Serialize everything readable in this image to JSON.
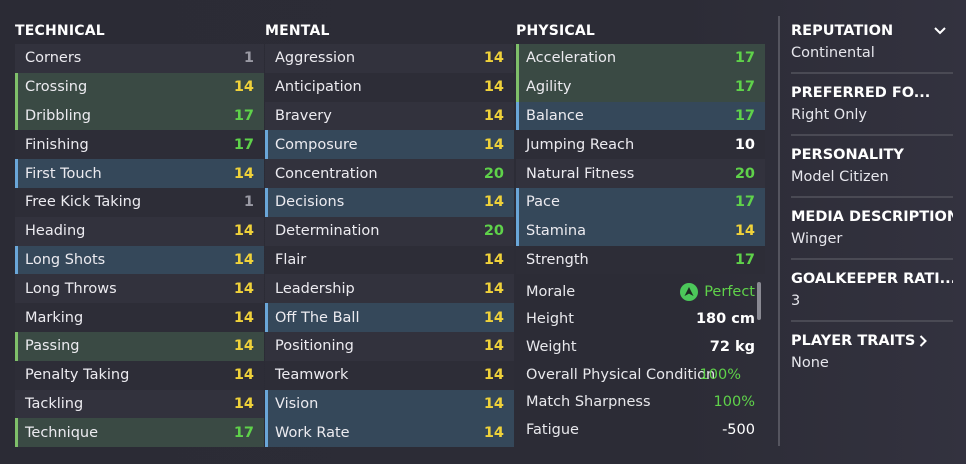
{
  "technical": {
    "title": "TECHNICAL",
    "rows": [
      {
        "name": "Corners",
        "value": "1",
        "color": "gray",
        "hl": ""
      },
      {
        "name": "Crossing",
        "value": "14",
        "color": "yellow",
        "hl": "green"
      },
      {
        "name": "Dribbling",
        "value": "17",
        "color": "green",
        "hl": "green"
      },
      {
        "name": "Finishing",
        "value": "17",
        "color": "green",
        "hl": ""
      },
      {
        "name": "First Touch",
        "value": "14",
        "color": "yellow",
        "hl": "blue"
      },
      {
        "name": "Free Kick Taking",
        "value": "1",
        "color": "gray",
        "hl": ""
      },
      {
        "name": "Heading",
        "value": "14",
        "color": "yellow",
        "hl": ""
      },
      {
        "name": "Long Shots",
        "value": "14",
        "color": "yellow",
        "hl": "blue"
      },
      {
        "name": "Long Throws",
        "value": "14",
        "color": "yellow",
        "hl": ""
      },
      {
        "name": "Marking",
        "value": "14",
        "color": "yellow",
        "hl": ""
      },
      {
        "name": "Passing",
        "value": "14",
        "color": "yellow",
        "hl": "green"
      },
      {
        "name": "Penalty Taking",
        "value": "14",
        "color": "yellow",
        "hl": ""
      },
      {
        "name": "Tackling",
        "value": "14",
        "color": "yellow",
        "hl": ""
      },
      {
        "name": "Technique",
        "value": "17",
        "color": "green",
        "hl": "green"
      }
    ]
  },
  "mental": {
    "title": "MENTAL",
    "rows": [
      {
        "name": "Aggression",
        "value": "14",
        "color": "yellow",
        "hl": ""
      },
      {
        "name": "Anticipation",
        "value": "14",
        "color": "yellow",
        "hl": ""
      },
      {
        "name": "Bravery",
        "value": "14",
        "color": "yellow",
        "hl": ""
      },
      {
        "name": "Composure",
        "value": "14",
        "color": "yellow",
        "hl": "blue"
      },
      {
        "name": "Concentration",
        "value": "20",
        "color": "green",
        "hl": ""
      },
      {
        "name": "Decisions",
        "value": "14",
        "color": "yellow",
        "hl": "blue"
      },
      {
        "name": "Determination",
        "value": "20",
        "color": "green",
        "hl": ""
      },
      {
        "name": "Flair",
        "value": "14",
        "color": "yellow",
        "hl": ""
      },
      {
        "name": "Leadership",
        "value": "14",
        "color": "yellow",
        "hl": ""
      },
      {
        "name": "Off The Ball",
        "value": "14",
        "color": "yellow",
        "hl": "blue"
      },
      {
        "name": "Positioning",
        "value": "14",
        "color": "yellow",
        "hl": ""
      },
      {
        "name": "Teamwork",
        "value": "14",
        "color": "yellow",
        "hl": ""
      },
      {
        "name": "Vision",
        "value": "14",
        "color": "yellow",
        "hl": "blue"
      },
      {
        "name": "Work Rate",
        "value": "14",
        "color": "yellow",
        "hl": "blue"
      }
    ]
  },
  "physical": {
    "title": "PHYSICAL",
    "rows": [
      {
        "name": "Acceleration",
        "value": "17",
        "color": "green",
        "hl": "green"
      },
      {
        "name": "Agility",
        "value": "17",
        "color": "green",
        "hl": "green"
      },
      {
        "name": "Balance",
        "value": "17",
        "color": "green",
        "hl": "blue"
      },
      {
        "name": "Jumping Reach",
        "value": "10",
        "color": "white",
        "hl": ""
      },
      {
        "name": "Natural Fitness",
        "value": "20",
        "color": "green",
        "hl": ""
      },
      {
        "name": "Pace",
        "value": "17",
        "color": "green",
        "hl": "blue"
      },
      {
        "name": "Stamina",
        "value": "14",
        "color": "yellow",
        "hl": "blue"
      },
      {
        "name": "Strength",
        "value": "17",
        "color": "green",
        "hl": ""
      }
    ]
  },
  "info": {
    "morale_label": "Morale",
    "morale_value": "Perfect",
    "height_label": "Height",
    "height_value": "180 cm",
    "weight_label": "Weight",
    "weight_value": "72 kg",
    "condition_label": "Overall Physical Condition",
    "condition_value": "100%",
    "sharpness_label": "Match Sharpness",
    "sharpness_value": "100%",
    "fatigue_label": "Fatigue",
    "fatigue_value": "-500"
  },
  "side": {
    "reputation_title": "REPUTATION",
    "reputation_value": "Continental",
    "foot_title": "PREFERRED FO...",
    "foot_value": "Right Only",
    "personality_title": "PERSONALITY",
    "personality_value": "Model Citizen",
    "media_title": "MEDIA DESCRIPTION",
    "media_value": "Winger",
    "gk_title": "GOALKEEPER RATI...",
    "gk_value": "3",
    "traits_title": "PLAYER TRAITS",
    "traits_value": "None"
  },
  "icons": {
    "morale": "morale-arrow-icon",
    "reputation_toggle": "chevron-down-icon",
    "traits_link": "chevron-right-icon"
  },
  "colors": {
    "yellow": "#f0d23a",
    "green": "#5fd24a",
    "gray": "#9a9aa4",
    "white": "#ffffff"
  }
}
